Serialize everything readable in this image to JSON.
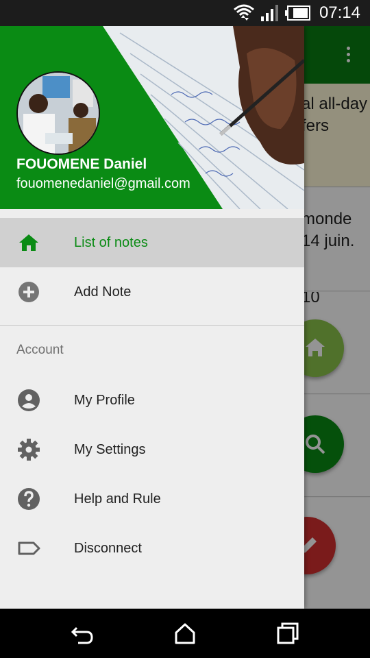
{
  "status_bar": {
    "time": "07:14"
  },
  "background": {
    "cards": [
      {
        "line1": "al all-day",
        "line2": "fers"
      },
      {
        "line1": "monde",
        "line2": "14 juin."
      },
      {
        "line1": "10",
        "line2": ""
      },
      {
        "line1": "",
        "line2": ""
      },
      {
        "line1": "",
        "line2": ""
      }
    ],
    "colors": {
      "toolbar": "#0a7d12",
      "fab_home": "#8bc34a",
      "fab_search": "#0a8b14",
      "fab_edit": "#d32f2f"
    }
  },
  "drawer": {
    "user": {
      "name": "FOUOMENE Daniel",
      "email": "fouomenedaniel@gmail.com"
    },
    "items": [
      {
        "label": "List of notes",
        "icon": "home-icon",
        "active": true
      },
      {
        "label": "Add Note",
        "icon": "add-circle-icon"
      }
    ],
    "account_header": "Account",
    "account_items": [
      {
        "label": "My Profile",
        "icon": "account-circle-icon"
      },
      {
        "label": "My Settings",
        "icon": "gear-icon"
      },
      {
        "label": "Help and Rule",
        "icon": "help-icon"
      },
      {
        "label": "Disconnect",
        "icon": "label-tag-icon"
      }
    ],
    "colors": {
      "header": "#0a8b14",
      "active_text": "#0a8b14"
    }
  },
  "nav_bar": {
    "buttons": [
      "back-icon",
      "home-icon",
      "recents-icon"
    ]
  }
}
